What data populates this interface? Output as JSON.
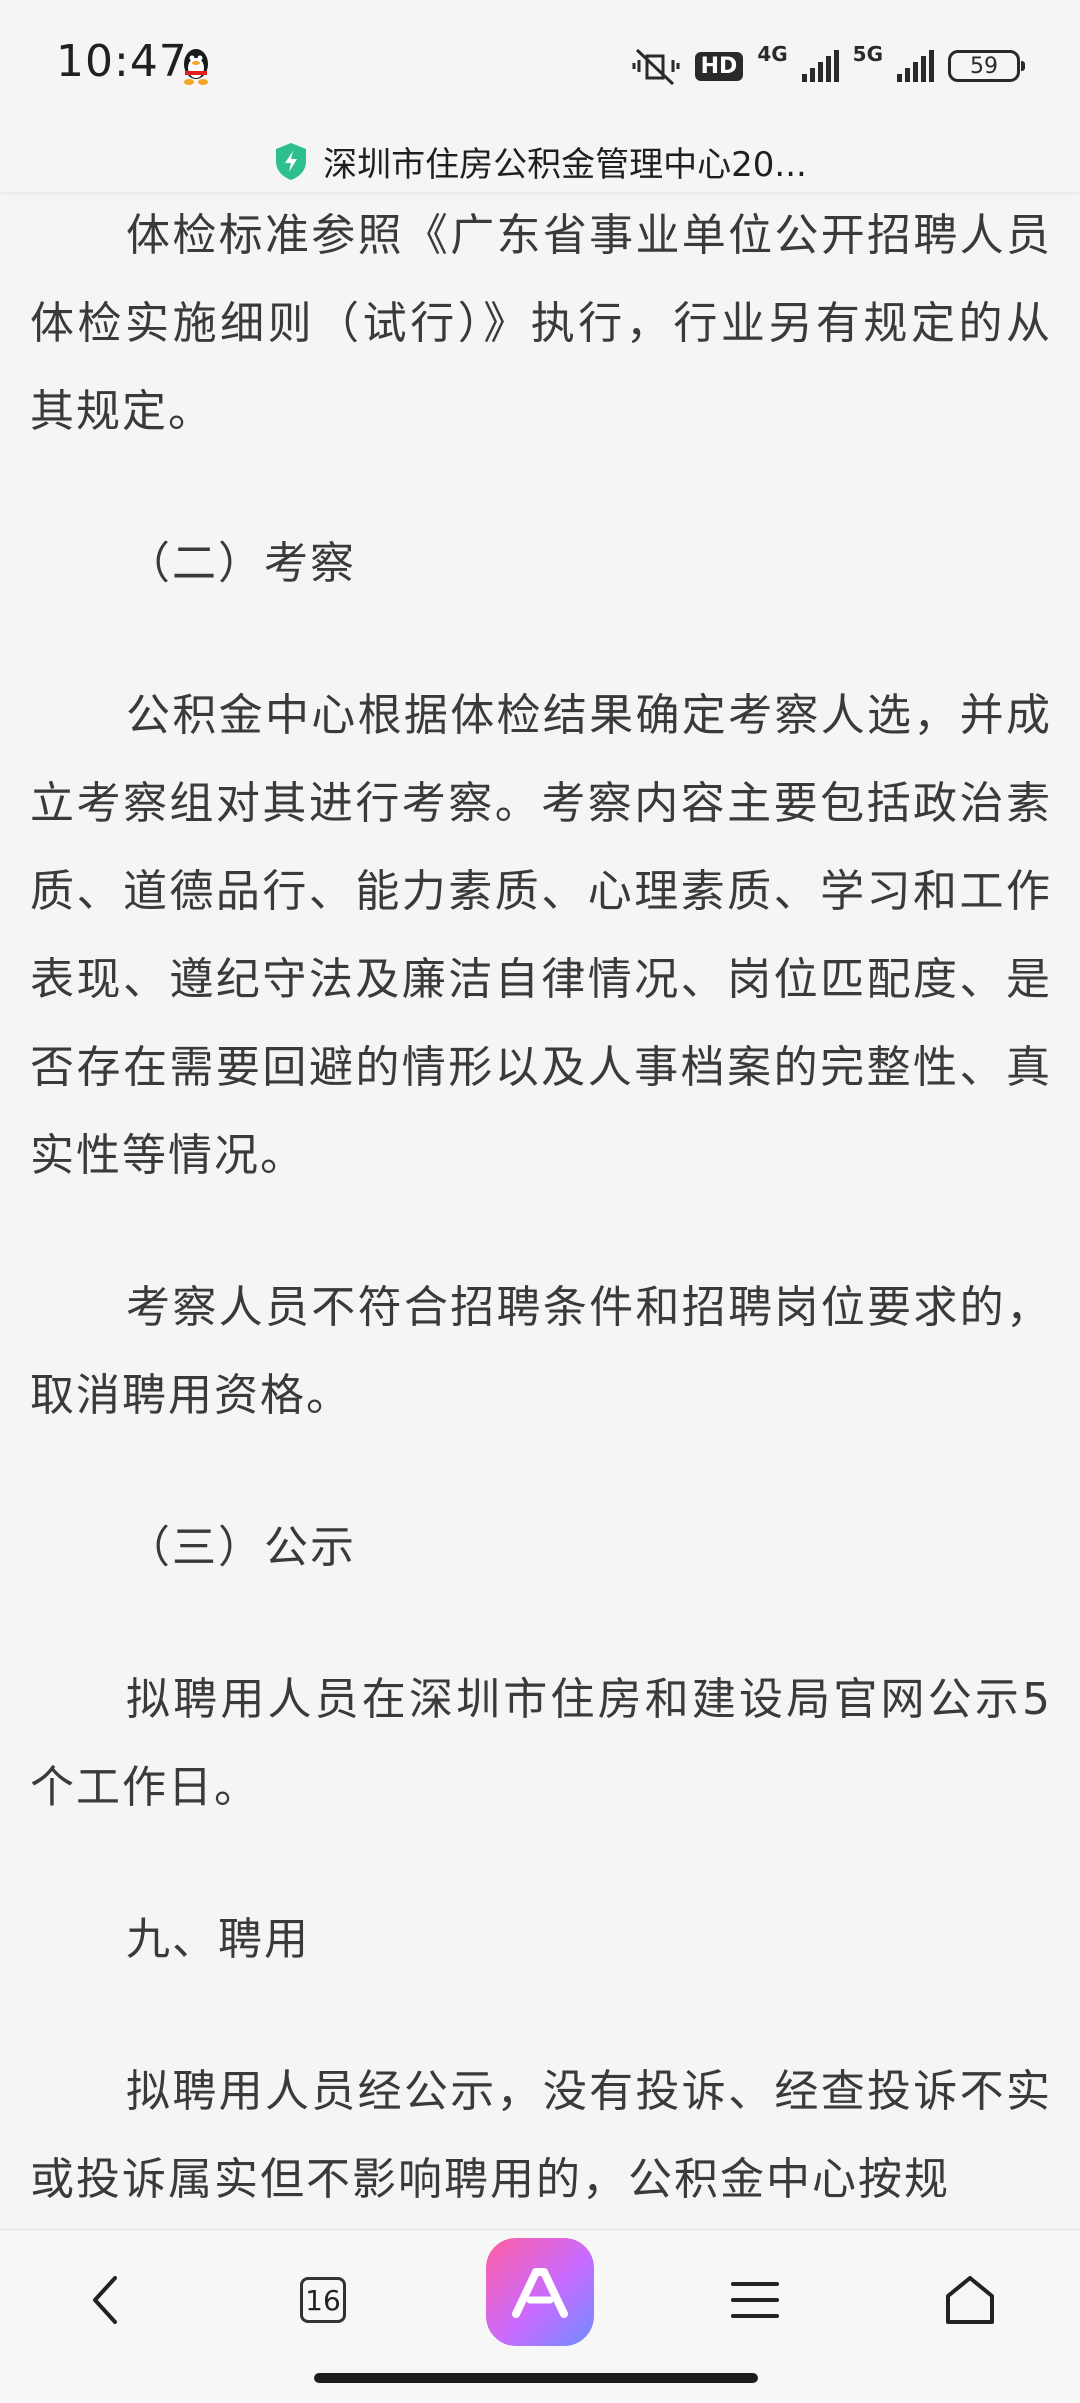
{
  "status_bar": {
    "time": "10:47",
    "hd_label": "HD",
    "net1": "4G",
    "net2": "5G",
    "battery": "59"
  },
  "title_bar": {
    "title": "深圳市住房公积金管理中心20..."
  },
  "article": {
    "p1": "体检标准参照《广东省事业单位公开招聘人员体检实施细则（试行）》执行，行业另有规定的从其规定。",
    "h2": "（二）考察",
    "p2": "公积金中心根据体检结果确定考察人选，并成立考察组对其进行考察。考察内容主要包括政治素质、道德品行、能力素质、心理素质、学习和工作表现、遵纪守法及廉洁自律情况、岗位匹配度、是否存在需要回避的情形以及人事档案的完整性、真实性等情况。",
    "p3": "考察人员不符合招聘条件和招聘岗位要求的，取消聘用资格。",
    "h3": "（三）公示",
    "p4": "拟聘用人员在深圳市住房和建设局官网公示5个工作日。",
    "h4": "九、聘用",
    "p5": "拟聘用人员经公示，没有投诉、经查投诉不实或投诉属实但不影响聘用的，公积金中心按规"
  },
  "bottom_nav": {
    "tab_count": "16"
  }
}
